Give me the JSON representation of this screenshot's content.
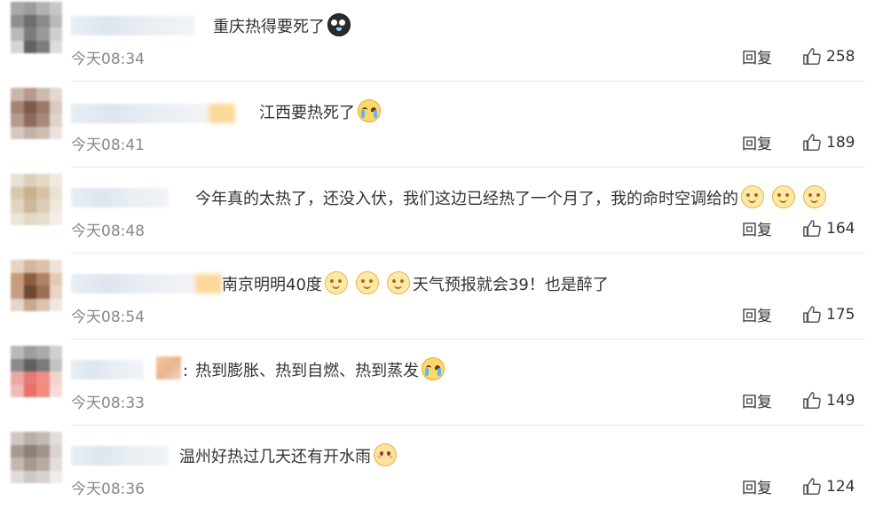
{
  "comments": [
    {
      "text": "重庆热得要死了",
      "emojis_after": [
        "crying-black-face"
      ],
      "time": "今天08:34",
      "reply": "回复",
      "likes": "258"
    },
    {
      "text": "江西要热死了",
      "emojis_after": [
        "crying-face"
      ],
      "time": "今天08:41",
      "reply": "回复",
      "likes": "189"
    },
    {
      "text": "今年真的太热了，还没入伏，我们这边已经热了一个月了，我的命时空调给的",
      "emojis_after": [
        "smiling-face",
        "smiling-face",
        "smiling-face"
      ],
      "time": "今天08:48",
      "reply": "回复",
      "likes": "164"
    },
    {
      "text_before": "南京明明40度",
      "text_after": "天气预报就会39！也是醉了",
      "emojis_middle": [
        "smiling-face",
        "smiling-face",
        "smiling-face"
      ],
      "time": "今天08:54",
      "reply": "回复",
      "likes": "175"
    },
    {
      "text": "热到膨胀、热到自燃、热到蒸发",
      "emojis_after": [
        "crying-face"
      ],
      "time": "今天08:33",
      "reply": "回复",
      "likes": "149"
    },
    {
      "text": "温州好热过几天还有开水雨",
      "emojis_after": [
        "blushing-face"
      ],
      "time": "今天08:36",
      "reply": "回复",
      "likes": "124"
    }
  ],
  "colors": {
    "text": "#333333",
    "meta": "#888888",
    "divider": "#e6e6e6"
  }
}
